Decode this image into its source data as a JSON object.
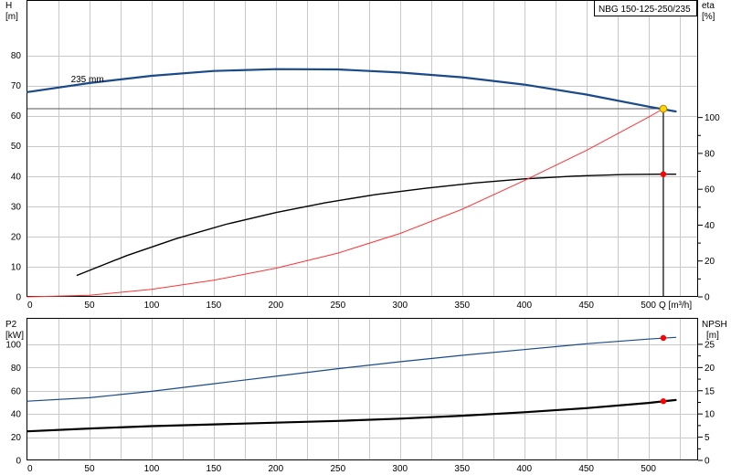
{
  "title_box": "NBG 150-125-250/235",
  "colors": {
    "head": "#1a4a8a",
    "eta": "#ff3333",
    "npsh_top": "#000000",
    "p2": "#1a4a8a",
    "npsh_bottom": "#000000",
    "duty_line": "#000000",
    "duty_marker_fill": "#ffd700",
    "point_marker": "#ff0000"
  },
  "chart_data": [
    {
      "type": "line",
      "panel": "top",
      "x_label": "Q [m³/h]",
      "y_left_label": [
        "H",
        "[m]"
      ],
      "y_right_label": [
        "eta",
        "[%]"
      ],
      "x_ticks": [
        0,
        50,
        100,
        150,
        200,
        250,
        300,
        350,
        400,
        450,
        500
      ],
      "y_left_ticks": [
        0,
        10,
        20,
        30,
        40,
        50,
        60,
        70,
        80
      ],
      "y_right_ticks": [
        0,
        20,
        40,
        60,
        80,
        100
      ],
      "xlim": [
        0,
        540
      ],
      "y_left_lim": [
        0,
        98
      ],
      "y_right_lim": [
        0,
        165
      ],
      "grid": true,
      "annotations": [
        {
          "text": "235 mm",
          "x": 35,
          "y": 72
        }
      ],
      "series": [
        {
          "key": "head",
          "axis": "left",
          "width": 2.2,
          "x": [
            0,
            50,
            100,
            150,
            200,
            250,
            300,
            350,
            400,
            450,
            500,
            522
          ],
          "y": [
            67.8,
            70.8,
            73.2,
            74.8,
            75.4,
            75.3,
            74.3,
            72.7,
            70.3,
            67.0,
            63.0,
            61.4
          ]
        },
        {
          "key": "npsh_top",
          "axis": "right",
          "width": 1.4,
          "x": [
            40,
            80,
            120,
            160,
            200,
            240,
            280,
            320,
            360,
            400,
            440,
            480,
            510,
            522
          ],
          "y": [
            12,
            23,
            32.5,
            40.5,
            47,
            52.5,
            57,
            60.5,
            63.5,
            65.8,
            67.3,
            68.2,
            68.4,
            68.4
          ]
        },
        {
          "key": "eta",
          "axis": "left",
          "width": 1,
          "x": [
            0,
            50,
            100,
            150,
            200,
            250,
            300,
            350,
            400,
            450,
            500,
            512
          ],
          "y": [
            0,
            0.5,
            2.5,
            5.5,
            9.5,
            14.5,
            21,
            29,
            38.5,
            48.5,
            59.5,
            62.3
          ]
        }
      ],
      "duty_point": {
        "x": 512,
        "y": 62.3,
        "reference_h": 62.3
      },
      "points": [
        {
          "series": "npsh_top",
          "x": 512,
          "y": 68.4
        }
      ]
    },
    {
      "type": "line",
      "panel": "bottom",
      "y_left_label": [
        "P2",
        "[kW]"
      ],
      "y_right_label": [
        "NPSH",
        "[m]"
      ],
      "x_ticks": [
        0,
        50,
        100,
        150,
        200,
        250,
        300,
        350,
        400,
        450,
        500
      ],
      "y_left_ticks": [
        0,
        20,
        40,
        60,
        80,
        100
      ],
      "y_right_ticks": [
        0,
        5,
        10,
        15,
        20,
        25
      ],
      "xlim": [
        0,
        540
      ],
      "y_left_lim": [
        0,
        122
      ],
      "y_right_lim": [
        0,
        30.5
      ],
      "grid": true,
      "series": [
        {
          "key": "p2",
          "axis": "left",
          "width": 1.2,
          "x": [
            0,
            50,
            100,
            150,
            200,
            250,
            300,
            350,
            400,
            450,
            500,
            522
          ],
          "y": [
            51,
            54,
            59.5,
            66,
            72.5,
            79,
            85,
            90.5,
            95.5,
            100.5,
            104.5,
            106
          ]
        },
        {
          "key": "npsh_bottom",
          "axis": "left",
          "width": 2.2,
          "x": [
            0,
            50,
            100,
            150,
            200,
            250,
            300,
            350,
            400,
            450,
            500,
            522
          ],
          "y": [
            25,
            27.5,
            29.5,
            31,
            32.5,
            34,
            36,
            38.5,
            41.5,
            45,
            49.5,
            52
          ]
        }
      ],
      "points": [
        {
          "series": "p2",
          "x": 512,
          "y": 105.5
        },
        {
          "series": "npsh_bottom",
          "x": 512,
          "y": 51
        }
      ]
    }
  ]
}
